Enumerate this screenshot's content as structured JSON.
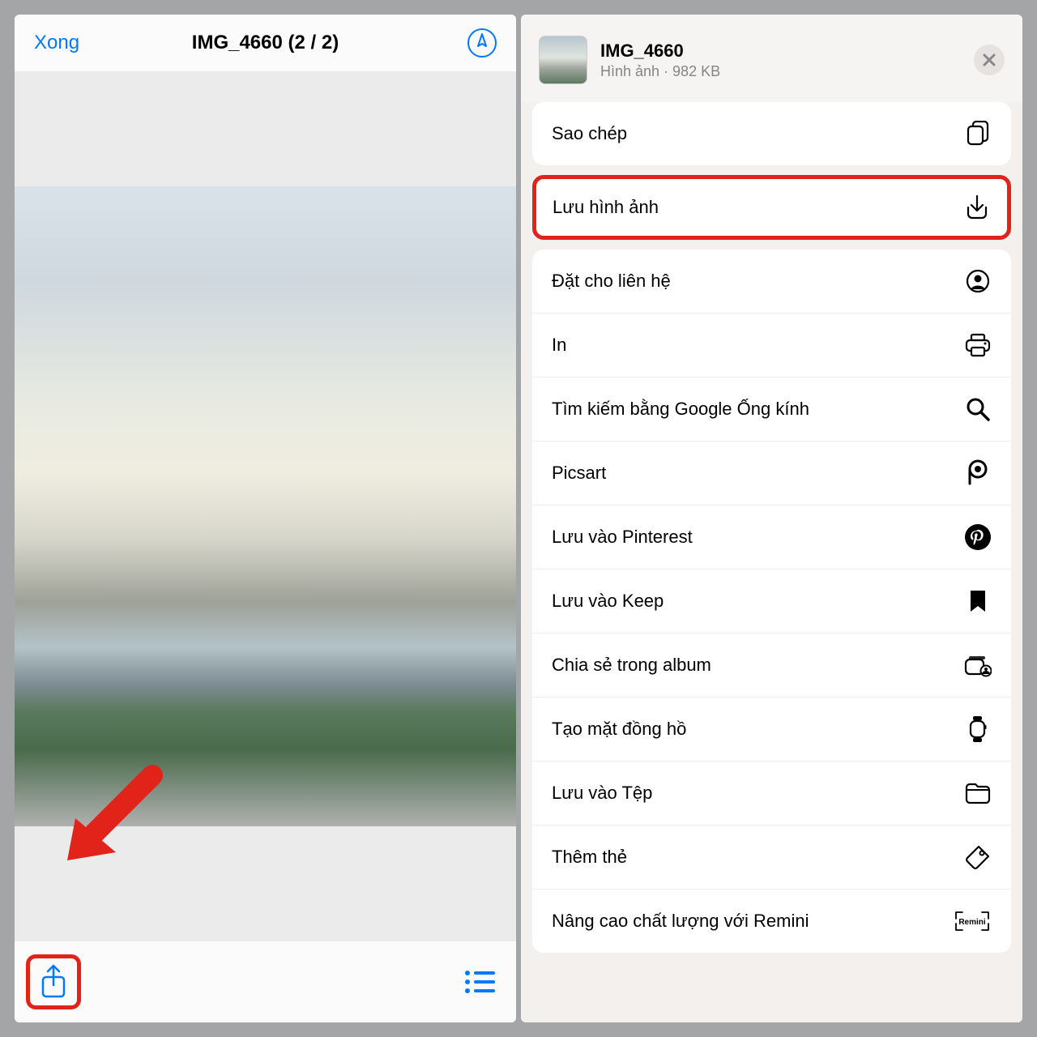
{
  "left": {
    "done": "Xong",
    "title": "IMG_4660 (2 / 2)"
  },
  "sheet": {
    "filename": "IMG_4660",
    "subtitle": "Hình ảnh · 982 KB"
  },
  "actions": {
    "copy": "Sao chép",
    "save_image": "Lưu hình ảnh",
    "assign_contact": "Đặt cho liên hệ",
    "print": "In",
    "google_lens": "Tìm kiếm bằng Google Ống kính",
    "picsart": "Picsart",
    "pinterest": "Lưu vào Pinterest",
    "keep": "Lưu vào Keep",
    "shared_album": "Chia sẻ trong album",
    "watch_face": "Tạo mặt đồng hồ",
    "save_files": "Lưu vào Tệp",
    "add_tags": "Thêm thẻ",
    "remini": "Nâng cao chất lượng với Remini",
    "remini_label": "Remini"
  }
}
